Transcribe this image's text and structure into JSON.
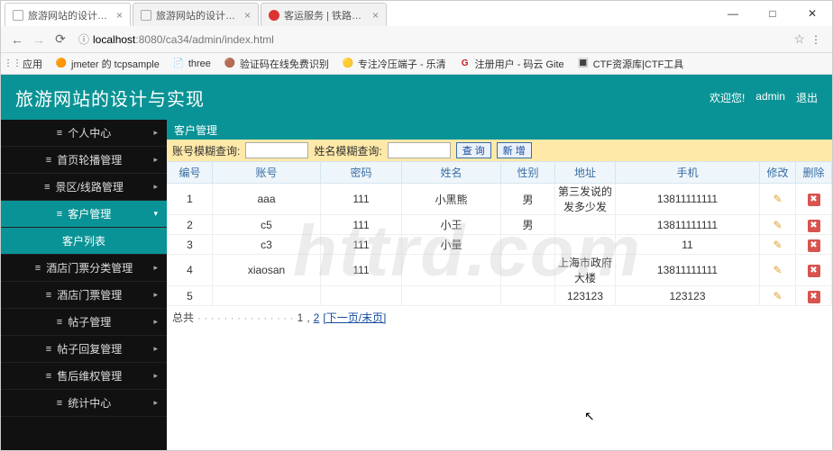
{
  "window": {
    "tabs": [
      {
        "title": "旅游网站的设计与实现",
        "active": true
      },
      {
        "title": "旅游网站的设计与实现",
        "active": false
      },
      {
        "title": "客运服务 | 铁路客户服务",
        "active": false
      }
    ],
    "url_host": "localhost",
    "url_port": ":8080",
    "url_path": "/ca34/admin/index.html",
    "win_min": "—",
    "win_max": "□",
    "win_close": "✕"
  },
  "bookmarks": [
    {
      "icon": "⋮⋮",
      "label": "应用"
    },
    {
      "icon": "🟠",
      "label": "jmeter 的 tcpsample"
    },
    {
      "icon": "📄",
      "label": "three"
    },
    {
      "icon": "🟤",
      "label": "验证码在线免费识别"
    },
    {
      "icon": "🟡",
      "label": "专注冷压端子 - 乐清"
    },
    {
      "icon": "G",
      "label": "注册用户 - 码云 Gite"
    },
    {
      "icon": "🔳",
      "label": "CTF资源库|CTF工具"
    }
  ],
  "header": {
    "title": "旅游网站的设计与实现",
    "welcome": "欢迎您!",
    "user": "admin",
    "logout": "退出"
  },
  "sidebar": [
    {
      "label": "个人中心",
      "active": false
    },
    {
      "label": "首页轮播管理",
      "active": false
    },
    {
      "label": "景区/线路管理",
      "active": false
    },
    {
      "label": "客户管理",
      "active": true
    },
    {
      "label": "客户列表",
      "active": false,
      "sub": true
    },
    {
      "label": "酒店门票分类管理",
      "active": false
    },
    {
      "label": "酒店门票管理",
      "active": false
    },
    {
      "label": "帖子管理",
      "active": false
    },
    {
      "label": "帖子回复管理",
      "active": false
    },
    {
      "label": "售后维权管理",
      "active": false
    },
    {
      "label": "统计中心",
      "active": false
    }
  ],
  "crumb": "客户管理",
  "filter": {
    "label_acc": "账号模糊查询:",
    "label_name": "姓名模糊查询:",
    "search": "查 询",
    "add": "新 增"
  },
  "table": {
    "cols": [
      "编号",
      "账号",
      "密码",
      "姓名",
      "性别",
      "地址",
      "手机",
      "修改",
      "删除"
    ],
    "rows": [
      {
        "id": "1",
        "acc": "aaa",
        "pwd": "111",
        "name": "小黑熊",
        "sex": "男",
        "addr": "第三发说的发多少发",
        "phone": "13811111111"
      },
      {
        "id": "2",
        "acc": "c5",
        "pwd": "111",
        "name": "小王",
        "sex": "男",
        "addr": "",
        "phone": "13811111111"
      },
      {
        "id": "3",
        "acc": "c3",
        "pwd": "111",
        "name": "小量",
        "sex": "",
        "addr": "",
        "phone": "11"
      },
      {
        "id": "4",
        "acc": "xiaosan",
        "pwd": "111",
        "name": "",
        "sex": "",
        "addr": "上海市政府大楼",
        "phone": "13811111111"
      },
      {
        "id": "5",
        "acc": "",
        "pwd": "",
        "name": "",
        "sex": "",
        "addr": "123123",
        "phone": "123123"
      }
    ]
  },
  "pager": {
    "prefix": "总共",
    "page1": "1",
    "page2": "2",
    "next": "[下一页/末页]"
  },
  "watermark": "httrd.com"
}
